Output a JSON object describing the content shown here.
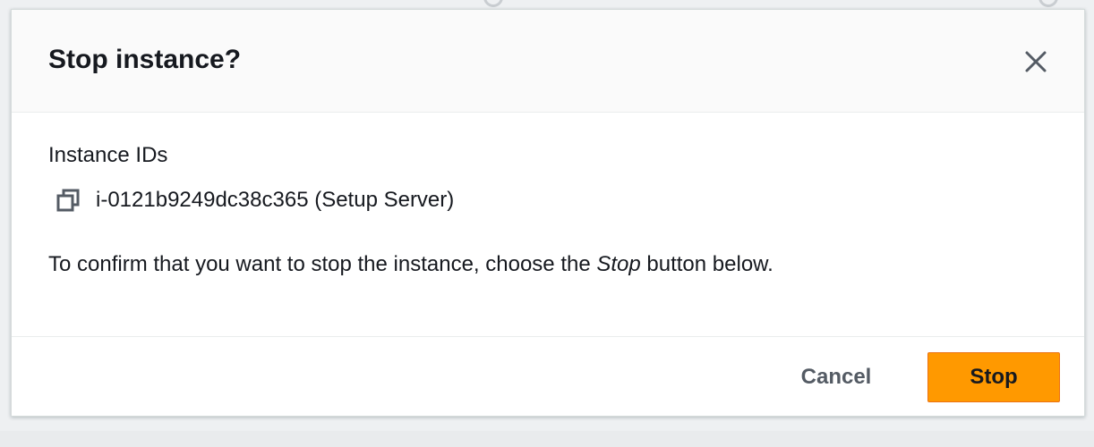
{
  "modal": {
    "title": "Stop instance?",
    "close_icon": "close-icon"
  },
  "body": {
    "field_label": "Instance IDs",
    "copy_icon": "copy-icon",
    "instance_id": "i-0121b9249dc38c365 (Setup Server)",
    "confirm_prefix": "To confirm that you want to stop the instance, choose the ",
    "confirm_emphasis": "Stop",
    "confirm_suffix": " button below."
  },
  "footer": {
    "cancel_label": "Cancel",
    "stop_label": "Stop"
  },
  "colors": {
    "primary_button": "#ff9900",
    "primary_button_border": "#ec7211",
    "header_background": "#fafafa",
    "text": "#16191f",
    "secondary_text": "#545b64"
  }
}
